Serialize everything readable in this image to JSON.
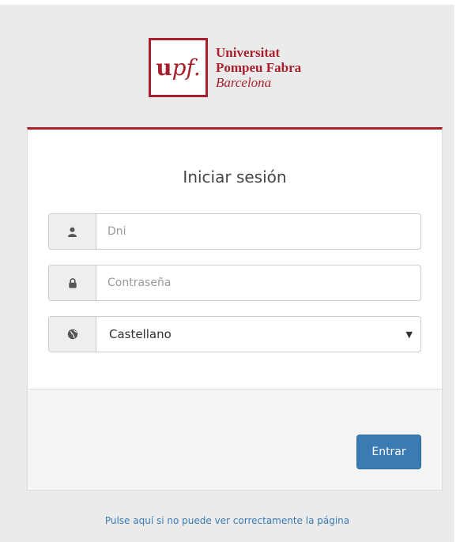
{
  "logo": {
    "mark_bold": "u",
    "mark_italic": "pf.",
    "line1": "Universitat",
    "line2": "Pompeu Fabra",
    "line3": "Barcelona"
  },
  "login": {
    "title": "Iniciar sesión",
    "dni_placeholder": "Dni",
    "password_placeholder": "Contraseña",
    "language_selected": "Castellano",
    "submit_label": "Entrar"
  },
  "footer": {
    "help_link": "Pulse aquí si no puede ver correctamente la página"
  },
  "icons": {
    "user": "user-icon",
    "lock": "lock-icon",
    "globe": "globe-icon",
    "caret": "caret-down-icon"
  },
  "colors": {
    "brand": "#a81f2d",
    "primary_button": "#3a7bb4",
    "background": "#ebebeb"
  }
}
